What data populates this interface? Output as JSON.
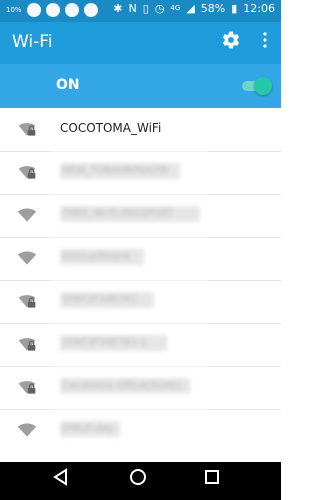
{
  "status_bar": {
    "left_small": "10%",
    "battery_percent": "58%",
    "time": "12:06",
    "cell_badge": "4G"
  },
  "app_bar": {
    "title": "Wi-Fi"
  },
  "wifi_toggle": {
    "label": "ON",
    "enabled": true
  },
  "networks": [
    {
      "ssid": "COCOTOMA_WiFi",
      "secured": true,
      "blurred": false
    },
    {
      "ssid": "NEW_TOBAHRP642IB",
      "secured": true,
      "blurred": true
    },
    {
      "ssid": "7REE_Wi-Fi_PASSPORT",
      "secured": false,
      "blurred": true
    },
    {
      "ssid": "0001softbank",
      "secured": false,
      "blurred": true
    },
    {
      "ssid": "106F3F34E7K1",
      "secured": true,
      "blurred": true
    },
    {
      "ssid": "106F3F34E7K1-1",
      "secured": true,
      "blurred": true
    },
    {
      "ssid": "Cocotoma-Office[5GHz]",
      "secured": true,
      "blurred": true
    },
    {
      "ssid": "DWLE-day",
      "secured": false,
      "blurred": true
    }
  ],
  "icons": {
    "gear": "gear-icon",
    "more": "more-vert-icon",
    "wifi": "wifi-icon",
    "lock": "lock-icon",
    "back": "nav-back-icon",
    "home": "nav-home-icon",
    "recent": "nav-recents-icon"
  },
  "colors": {
    "status_bar": "#1a8ac4",
    "app_bar": "#1f9cdb",
    "on_bar": "#33a7e6",
    "toggle_thumb": "#24c9a8",
    "toggle_track": "#6ed6c6"
  }
}
